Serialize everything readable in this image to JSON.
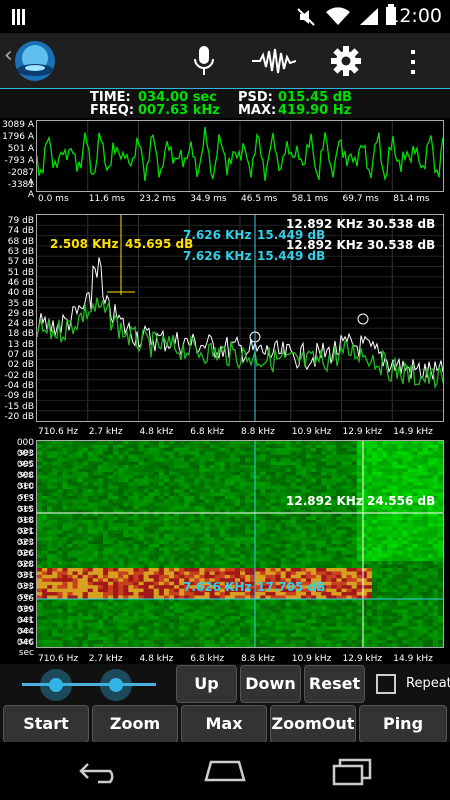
{
  "status": {
    "time": "12:00"
  },
  "info": {
    "time_label": "TIME:",
    "time_value": "034.00 sec",
    "freq_label": "FREQ:",
    "freq_value": "007.63 kHz",
    "psd_label": "PSD:",
    "psd_value": "015.45 dB",
    "max_label": "MAX:",
    "max_value": "419.90 Hz"
  },
  "wave": {
    "y_labels": [
      "3089 A",
      "1796 A",
      "501 A",
      "-793 A",
      "-2087 A",
      "-3381 A"
    ],
    "x_labels": [
      "0.0 ms",
      "11.6 ms",
      "23.2 ms",
      "34.9 ms",
      "46.5 ms",
      "58.1 ms",
      "69.7 ms",
      "81.4 ms"
    ]
  },
  "spectrum": {
    "y_labels": [
      "79 dB",
      "74 dB",
      "68 dB",
      "63 dB",
      "57 dB",
      "51 dB",
      "46 dB",
      "40 dB",
      "35 dB",
      "29 dB",
      "24 dB",
      "18 dB",
      "13 dB",
      "07 dB",
      "02 dB",
      "-02 dB",
      "-04 dB",
      "-09 dB",
      "-15 dB",
      "-20 dB"
    ],
    "x_labels": [
      "710.6 Hz",
      "2.7 kHz",
      "4.8 kHz",
      "6.8 kHz",
      "8.8 kHz",
      "10.9 kHz",
      "12.9 kHz",
      "14.9 kHz"
    ],
    "peak_freq": "2.508 KHz",
    "peak_db": "45.695 dB",
    "cursor1_freq": "7.626 KHz",
    "cursor1_db": "15.449 dB",
    "cursor2_freq": "7.626 KHz",
    "cursor2_db": "15.449 dB",
    "cursor3_freq": "12.892 KHz",
    "cursor3_db": "30.538 dB",
    "cursor4_freq": "12.892 KHz",
    "cursor4_db": "30.538 dB"
  },
  "waterfall": {
    "y_labels": [
      "000 sec",
      "003 sec",
      "005 sec",
      "008 sec",
      "010 sec",
      "013 sec",
      "015 sec",
      "018 sec",
      "021 sec",
      "023 sec",
      "026 sec",
      "028 sec",
      "031 sec",
      "033 sec",
      "036 sec",
      "039 sec",
      "041 sec",
      "044 sec",
      "046 sec"
    ],
    "x_labels": [
      "710.6 Hz",
      "2.7 kHz",
      "4.8 kHz",
      "6.8 kHz",
      "8.8 kHz",
      "10.9 kHz",
      "12.9 kHz",
      "14.9 kHz"
    ],
    "marker1_freq": "12.892 KHz",
    "marker1_db": "24.556 dB",
    "marker2_freq": "7.626 KHz",
    "marker2_db": "17.705 dB"
  },
  "controls": {
    "up": "Up",
    "down": "Down",
    "reset": "Reset",
    "repeat": "Repeat",
    "start": "Start",
    "zoom": "Zoom",
    "max": "Max",
    "zoomout": "ZoomOut",
    "ping": "Ping"
  },
  "icons": {
    "app": "app-logo-icon",
    "mic": "microphone-icon",
    "wave": "waveform-icon",
    "settings": "gear-icon",
    "overflow": "overflow-menu-icon"
  },
  "colors": {
    "accent": "#33b5e5",
    "signal": "#00e000",
    "cursor": "#33d0e8",
    "peak": "#ffe000"
  }
}
